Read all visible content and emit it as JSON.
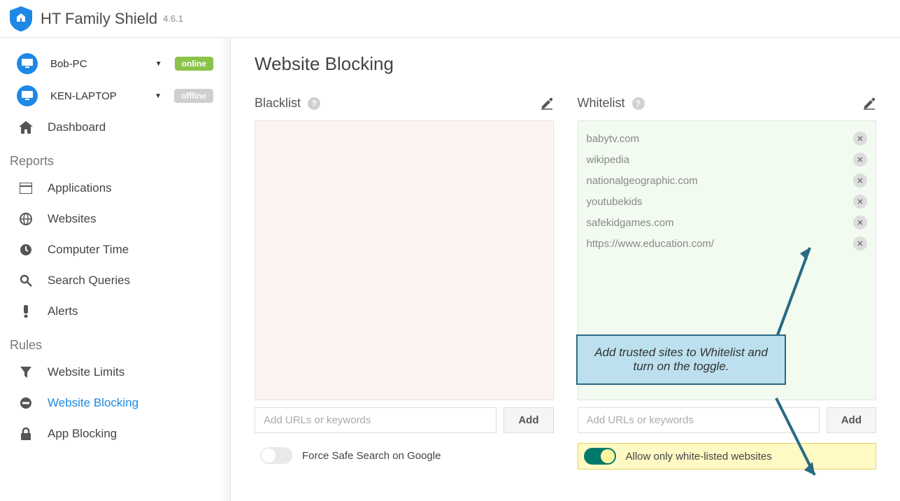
{
  "app": {
    "title": "HT Family Shield",
    "version": "4.6.1"
  },
  "devices": [
    {
      "name": "Bob-PC",
      "status": "online"
    },
    {
      "name": "KEN-LAPTOP",
      "status": "offline"
    }
  ],
  "nav": {
    "dashboard": "Dashboard",
    "reports_label": "Reports",
    "reports": {
      "applications": "Applications",
      "websites": "Websites",
      "computer_time": "Computer Time",
      "search_queries": "Search Queries",
      "alerts": "Alerts"
    },
    "rules_label": "Rules",
    "rules": {
      "website_limits": "Website Limits",
      "website_blocking": "Website Blocking",
      "app_blocking": "App Blocking"
    }
  },
  "page": {
    "title": "Website Blocking",
    "blacklist_label": "Blacklist",
    "whitelist_label": "Whitelist",
    "add_placeholder": "Add URLs or keywords",
    "add_button": "Add",
    "safe_search_label": "Force Safe Search on Google",
    "whitelist_only_label": "Allow only white-listed websites",
    "callout_text": "Add trusted sites to Whitelist and turn on the toggle."
  },
  "blacklist": [],
  "whitelist": [
    "babytv.com",
    "wikipedia",
    "nationalgeographic.com",
    "youtubekids",
    "safekidgames.com",
    "https://www.education.com/"
  ],
  "toggles": {
    "safe_search": false,
    "whitelist_only": true
  }
}
